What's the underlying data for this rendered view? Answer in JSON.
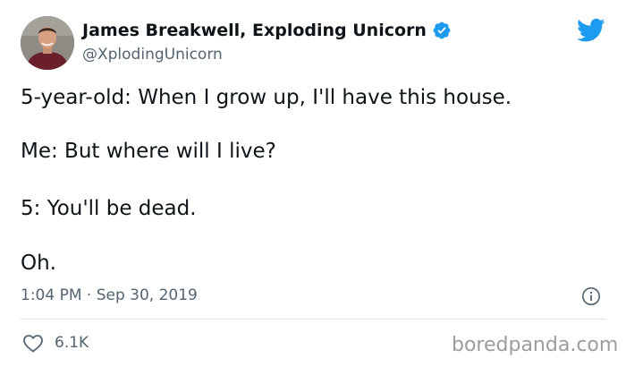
{
  "author": {
    "display_name": "James Breakwell, Exploding Unicorn",
    "handle": "@XplodingUnicorn",
    "verified_icon": "verified-badge-icon",
    "avatar_icon": "avatar"
  },
  "platform_icon": "twitter-bird-icon",
  "tweet": {
    "lines": [
      "5-year-old: When I grow up, I'll have this house.",
      "Me: But where will I live?",
      "5: You'll be dead.",
      "Oh."
    ]
  },
  "meta": {
    "timestamp": "1:04 PM · Sep 30, 2019",
    "info_icon": "info-icon"
  },
  "actions": {
    "like_icon": "heart-icon",
    "like_count": "6.1K"
  },
  "watermark": "boredpanda.com",
  "colors": {
    "accent": "#1d9bf0",
    "text": "#0f1419",
    "secondary_text": "#536471",
    "divider": "#dfe3e7",
    "watermark": "#9a9ca0"
  }
}
